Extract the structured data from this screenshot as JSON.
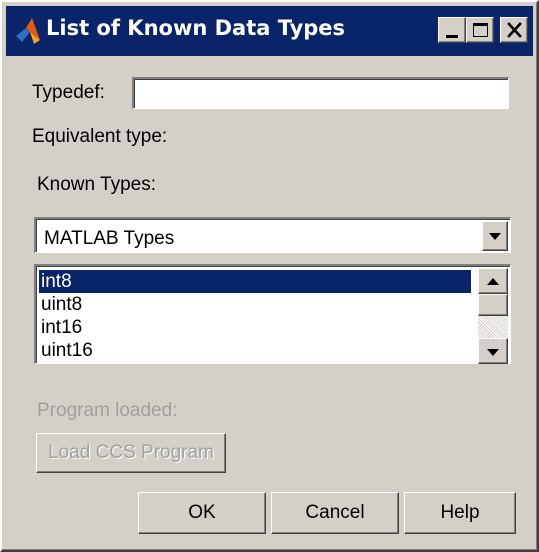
{
  "window": {
    "title": "List of Known Data Types",
    "minimize_icon": "minimize-icon",
    "maximize_icon": "maximize-icon",
    "close_icon": "close-icon",
    "app_icon": "matlab-logo-icon",
    "colors": {
      "titlebar": "#0a246a",
      "face": "#d4d0c8",
      "selection": "#0a246a"
    }
  },
  "typedef": {
    "label": "Typedef:",
    "value": "",
    "placeholder": ""
  },
  "equivalent_type": {
    "label": "Equivalent type:"
  },
  "known_types": {
    "label": "Known Types:",
    "selected": "MATLAB Types",
    "dropdown_icon": "chevron-down-icon"
  },
  "types_list": {
    "items": [
      "int8",
      "uint8",
      "int16",
      "uint16"
    ],
    "selected_index": 0
  },
  "program": {
    "label": "Program loaded:",
    "load_button": "Load CCS Program"
  },
  "buttons": {
    "ok": "OK",
    "cancel": "Cancel",
    "help": "Help"
  }
}
